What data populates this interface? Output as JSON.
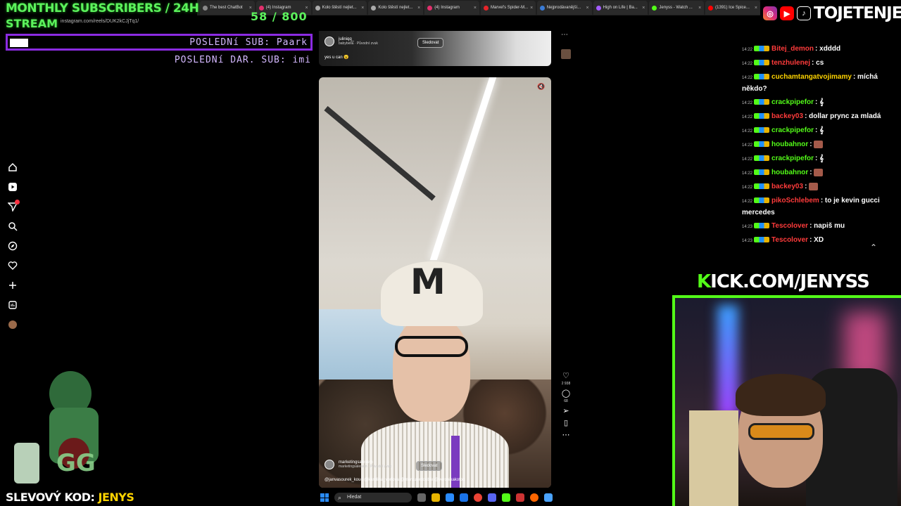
{
  "overlay": {
    "monthly_title": "MONTHLY SUBSCRIBERS / 24H",
    "stream_label": "STREAM",
    "sub_count": "58 / 800",
    "last_sub_label": "POSLEDNí SUB: Paark",
    "last_dar_label": "POSLEDNí DAR. SUB: imi",
    "brand": "TOJETENJENYS",
    "kick_k": "K",
    "kick_rest": "ICK.COM/JENYSS",
    "promo_label": "SLEVOVÝ KOD:",
    "promo_code": "JENYS"
  },
  "browser": {
    "url": "instagram.com/reels/DUK2kCJjTq1/",
    "tabs": [
      {
        "label": "The best ChatBot",
        "color": "#888888"
      },
      {
        "label": "(4) Instagram",
        "color": "#e1306c"
      },
      {
        "label": "Kolo štěstí nejlet...",
        "color": "#aaaaaa"
      },
      {
        "label": "Kolo štěstí nejlet...",
        "color": "#aaaaaa"
      },
      {
        "label": "(4) Instagram",
        "color": "#e1306c"
      },
      {
        "label": "Marvel's Spider-M...",
        "color": "#e62429"
      },
      {
        "label": "Nejprodávanější...",
        "color": "#3a7bd5"
      },
      {
        "label": "High on Life | Ba...",
        "color": "#a35cff"
      },
      {
        "label": "Jenyss - Watch ...",
        "color": "#53fc18"
      },
      {
        "label": "(1391) Ice Spice...",
        "color": "#ff0000"
      }
    ]
  },
  "reels": {
    "top": {
      "username": "juliniqq_",
      "audio": "babybella · Původní zvuk",
      "follow_label": "Sledovat",
      "caption": "yes u can 😮"
    },
    "main": {
      "username": "marketingsalesem",
      "audio": "marketingsalesem · Původní zvuk",
      "follow_label": "Sledovat",
      "caption": "@janvasourek_kouc @karolina_vorlova @marcusxdouble @veronikakotoc",
      "like_count": "2 938",
      "comment_count": "68"
    }
  },
  "chat": {
    "messages": [
      {
        "time": "14:22",
        "user": "Bitej_demon",
        "color": "#ff3b3b",
        "text": ": xdddd"
      },
      {
        "time": "14:22",
        "user": "tenzhulenej",
        "color": "#ff3b3b",
        "text": ": cs"
      },
      {
        "time": "14:22",
        "user": "cuchamtangatvojimamy",
        "color": "#ffd400",
        "text": ": míchá někdo?"
      },
      {
        "time": "14:22",
        "user": "crackpipefor",
        "color": "#53fc18",
        "text": ": 𝄞"
      },
      {
        "time": "14:22",
        "user": "backey03",
        "color": "#ff3b3b",
        "text": ": dollar prync za mladá"
      },
      {
        "time": "14:22",
        "user": "crackpipefor",
        "color": "#53fc18",
        "text": ": 𝄞"
      },
      {
        "time": "14:22",
        "user": "houbahnor",
        "color": "#53fc18",
        "text": ":"
      },
      {
        "time": "14:22",
        "user": "crackpipefor",
        "color": "#53fc18",
        "text": ": 𝄞"
      },
      {
        "time": "14:22",
        "user": "houbahnor",
        "color": "#53fc18",
        "text": ":"
      },
      {
        "time": "14:22",
        "user": "backey03",
        "color": "#ff3b3b",
        "text": ":"
      },
      {
        "time": "14:22",
        "user": "pikoSchlebem",
        "color": "#ff3b3b",
        "text": ": to je kevin gucci mercedes"
      },
      {
        "time": "14:23",
        "user": "Tescolover",
        "color": "#ff3b3b",
        "text": ": napiš mu"
      },
      {
        "time": "14:23",
        "user": "Tescolover",
        "color": "#ff3b3b",
        "text": ": XD"
      }
    ]
  },
  "taskbar": {
    "search_placeholder": "Hledat"
  },
  "colors": {
    "accent_green": "#53fc18",
    "overlay_green": "#5cf25c",
    "purple": "#8b2be2"
  }
}
